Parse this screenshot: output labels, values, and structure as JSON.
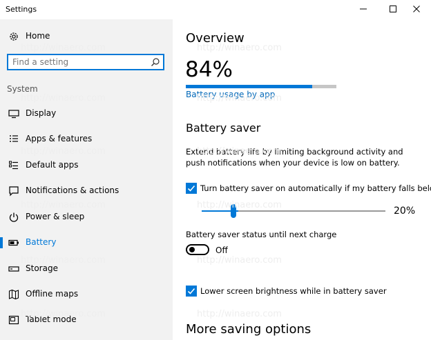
{
  "window": {
    "title": "Settings"
  },
  "sidebar": {
    "home_label": "Home",
    "search_placeholder": "Find a setting",
    "section_label": "System",
    "items": [
      {
        "label": "Display",
        "icon": "display-icon"
      },
      {
        "label": "Apps & features",
        "icon": "apps-features-icon"
      },
      {
        "label": "Default apps",
        "icon": "default-apps-icon"
      },
      {
        "label": "Notifications & actions",
        "icon": "notifications-icon"
      },
      {
        "label": "Power & sleep",
        "icon": "power-icon"
      },
      {
        "label": "Battery",
        "icon": "battery-icon",
        "active": true
      },
      {
        "label": "Storage",
        "icon": "storage-icon"
      },
      {
        "label": "Offline maps",
        "icon": "map-icon"
      },
      {
        "label": "Tablet mode",
        "icon": "tablet-icon"
      }
    ]
  },
  "main": {
    "overview_heading": "Overview",
    "battery_percent": "84%",
    "battery_level": 0.84,
    "usage_link": "Battery usage by app",
    "saver_heading": "Battery saver",
    "saver_description": "Extend battery life by limiting background activity and push notifications when your device is low on battery.",
    "auto_on_label": "Turn battery saver on automatically if my battery falls below:",
    "auto_on_checked": true,
    "threshold_value": "20%",
    "threshold_level": 0.2,
    "status_label": "Battery saver status until next charge",
    "status_toggle_value": "Off",
    "lower_brightness_label": "Lower screen brightness while in battery saver",
    "lower_brightness_checked": true,
    "more_heading": "More saving options"
  },
  "watermark": "http://winaero.com",
  "colors": {
    "accent": "#0078d7",
    "sidebar_bg": "#f2f2f2",
    "link": "#0067b8"
  }
}
